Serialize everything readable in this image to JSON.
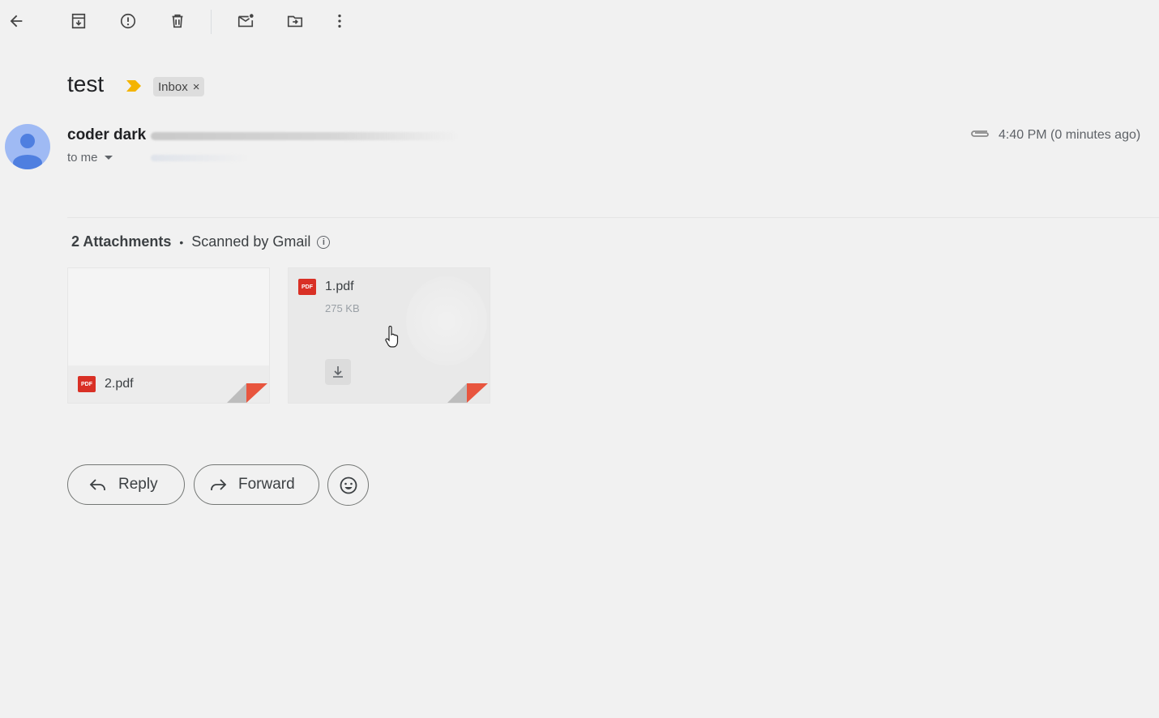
{
  "toolbar": {
    "items": [
      "back-icon",
      "archive-icon",
      "report-spam-icon",
      "delete-icon",
      "mark-unread-icon",
      "move-to-icon",
      "more-icon"
    ]
  },
  "message": {
    "subject": "test",
    "label": "Inbox",
    "label_remove": "×",
    "sender_name": "coder dark",
    "recipient": "to me",
    "timestamp": "4:40 PM (0 minutes ago)"
  },
  "attachments": {
    "count_label": "2 Attachments",
    "separator": "•",
    "scanned_label": "Scanned by Gmail",
    "info_glyph": "i",
    "items": [
      {
        "name": "2.pdf",
        "type_badge": "PDF"
      },
      {
        "name": "1.pdf",
        "size": "275 KB",
        "type_badge": "PDF"
      }
    ]
  },
  "actions": {
    "reply_label": "Reply",
    "forward_label": "Forward"
  },
  "colors": {
    "background": "#f1f1f1",
    "pdf_red": "#d93025",
    "avatar_blue": "#4f7fe0",
    "importance_yellow": "#f4b400"
  }
}
